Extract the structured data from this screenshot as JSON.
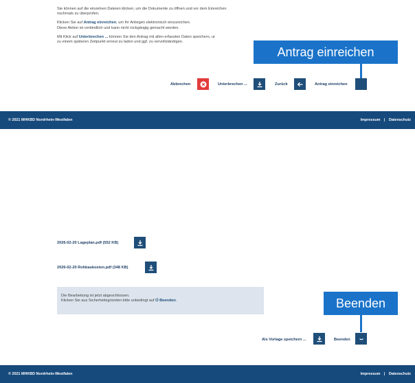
{
  "top": {
    "line1": "Sie können auf die einzelnen Dateien klicken, um die Dokumente zu öffnen und vor dem Einreichen",
    "line2": "nochmals zu überprüfen.",
    "line3_pre": "Klicken Sie auf ",
    "line3_bold": "Antrag einreichen",
    "line3_post": ", um Ihr Anliegen elektronisch einzureichen.",
    "line4": "Diese Aktion ist verbindlich und kann nicht rückgängig gemacht werden.",
    "line5_pre": "Mit Klick auf ",
    "line5_bold": "Unterbrechen ...",
    "line5_post": " können Sie den Antrag mit allen erfassten Daten speichern, ur",
    "line6": "zu einem späteren Zeitpunkt erneut zu laden und ggf. zu vervollständigen."
  },
  "buttons_top": {
    "abbrechen": "Abbrechen",
    "unterbrechen": "Unterbrechen ...",
    "zurueck": "Zurück",
    "antrag": "Antrag einreichen"
  },
  "callout_top": "Antrag einreichen",
  "footer": {
    "copyright": "© 2021 MHKBD Nordrhein-Westfalen",
    "impressum": "Impressum",
    "separator": "|",
    "datenschutz": "Datenschutz"
  },
  "files": [
    {
      "label": "2026-02-20 Lageplan.pdf (552 KB)"
    },
    {
      "label": "2026-02-20 Rohbaukosten.pdf (348 KB)"
    }
  ],
  "notice": {
    "line1": "Die Bearbeitung ist jetzt abgeschlossen.",
    "line2_pre": "Klicken Sie aus Sicherheitsgründen bitte unbedingt auf ",
    "line2_bold": "Beenden",
    "line2_post": "."
  },
  "buttons_bottom": {
    "vorlage": "Als Vorlage speichern ...",
    "beenden": "Beenden"
  },
  "callout_bottom": "Beenden",
  "colors": {
    "primary": "#1f4e79",
    "footer": "#174a7c",
    "callout": "#1a73c9",
    "danger": "#e23b3b",
    "notice": "#dde4ee"
  }
}
